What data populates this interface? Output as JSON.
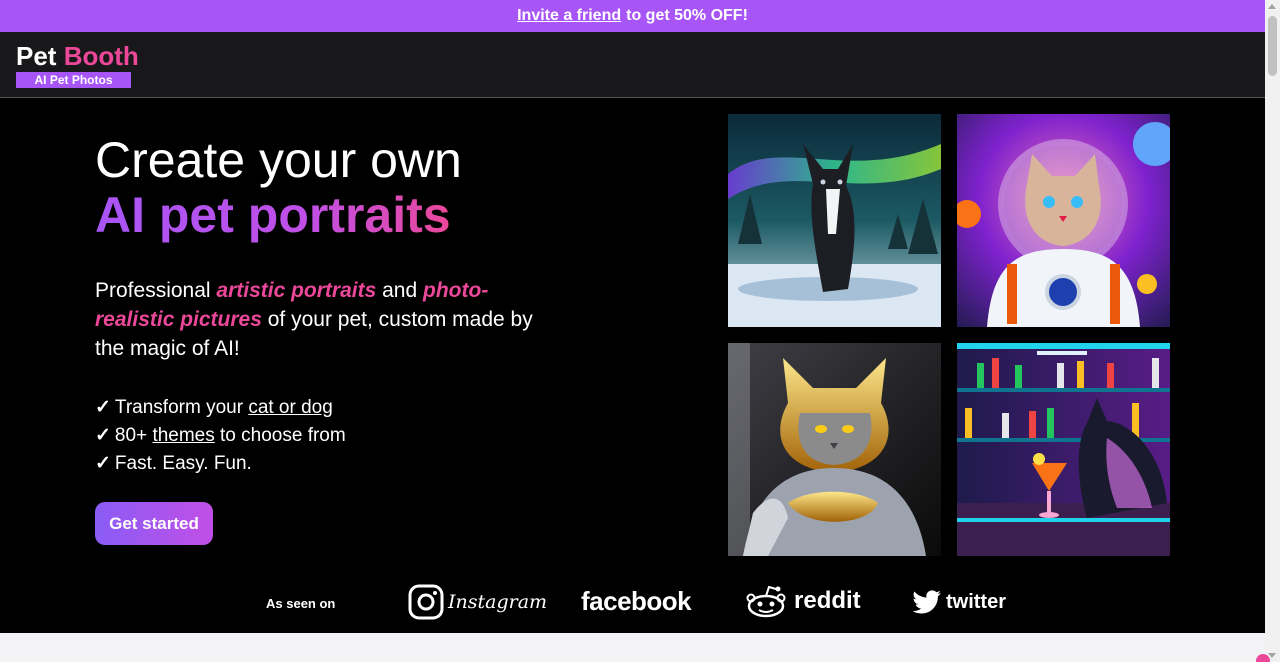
{
  "promo": {
    "link_text": "Invite a friend",
    "rest_text": "to get 50% OFF!"
  },
  "logo": {
    "word1": "Pet",
    "word2": "Booth",
    "badge": "AI Pet Photos"
  },
  "hero": {
    "title_line1": "Create your own",
    "title_line2": "AI pet portraits",
    "desc": {
      "part1": "Professional ",
      "hl1": "artistic portraits",
      "part2": " and ",
      "hl2": "photo-realistic pictures",
      "part3": " of your pet, custom made by the magic of AI!"
    },
    "features": [
      {
        "check": "✓",
        "pre": "Transform your ",
        "link": "cat or dog",
        "post": ""
      },
      {
        "check": "✓",
        "pre": "80+ ",
        "link": "themes",
        "post": " to choose from"
      },
      {
        "check": "✓",
        "pre": "Fast. Easy. Fun.",
        "link": "",
        "post": ""
      }
    ],
    "cta": "Get started"
  },
  "gallery": [
    {
      "name": "dog-aurora-image"
    },
    {
      "name": "cat-astronaut-image"
    },
    {
      "name": "cat-knight-image"
    },
    {
      "name": "dog-bar-image"
    }
  ],
  "seen_on": {
    "label": "As seen on",
    "brands": [
      "Instagram",
      "facebook",
      "reddit",
      "twitter"
    ]
  },
  "colors": {
    "accent_purple": "#a855f7",
    "accent_pink": "#ec4899",
    "header_bg": "#18181b",
    "hero_bg": "#000000"
  }
}
